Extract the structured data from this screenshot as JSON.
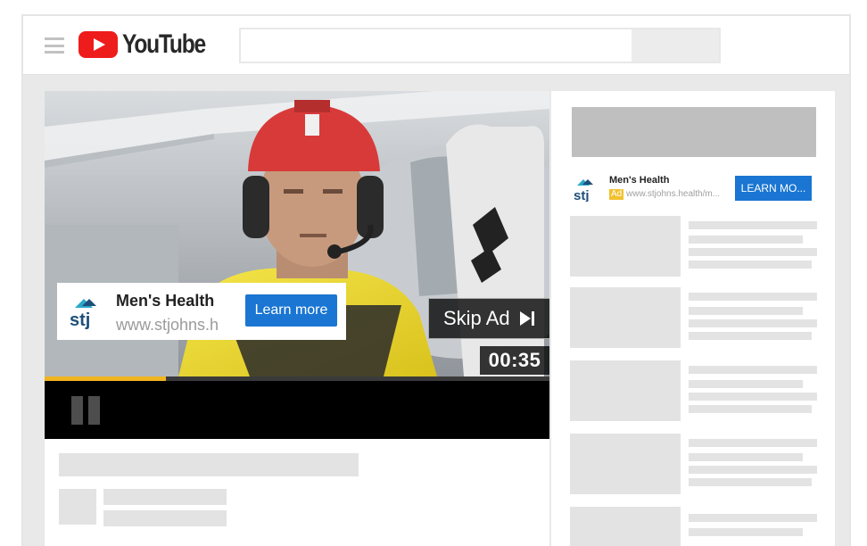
{
  "header": {
    "logo_text": "YouTube",
    "search": {
      "placeholder": ""
    }
  },
  "video": {
    "progress_fraction": 0.24,
    "ad": {
      "advertiser": "Men's Health",
      "url": "www.stjohns.h",
      "cta_label": "Learn more"
    },
    "skip_label": "Skip Ad",
    "countdown": "00:35"
  },
  "sidebar": {
    "companion_ad": {
      "advertiser": "Men's Health",
      "ad_tag": "Ad",
      "url": "www.stjohns.health/m...",
      "cta_label": "LEARN MO..."
    }
  },
  "colors": {
    "brand_red": "#ee1c1b",
    "cta_blue": "#1a76d2",
    "progress_yellow": "#f0b51f",
    "ad_tag_yellow": "#f2c12e",
    "placeholder_gray": "#e3e3e3"
  },
  "icons": [
    "menu-icon",
    "youtube-play-icon",
    "pause-icon",
    "skip-icon",
    "stj-logo-icon"
  ]
}
